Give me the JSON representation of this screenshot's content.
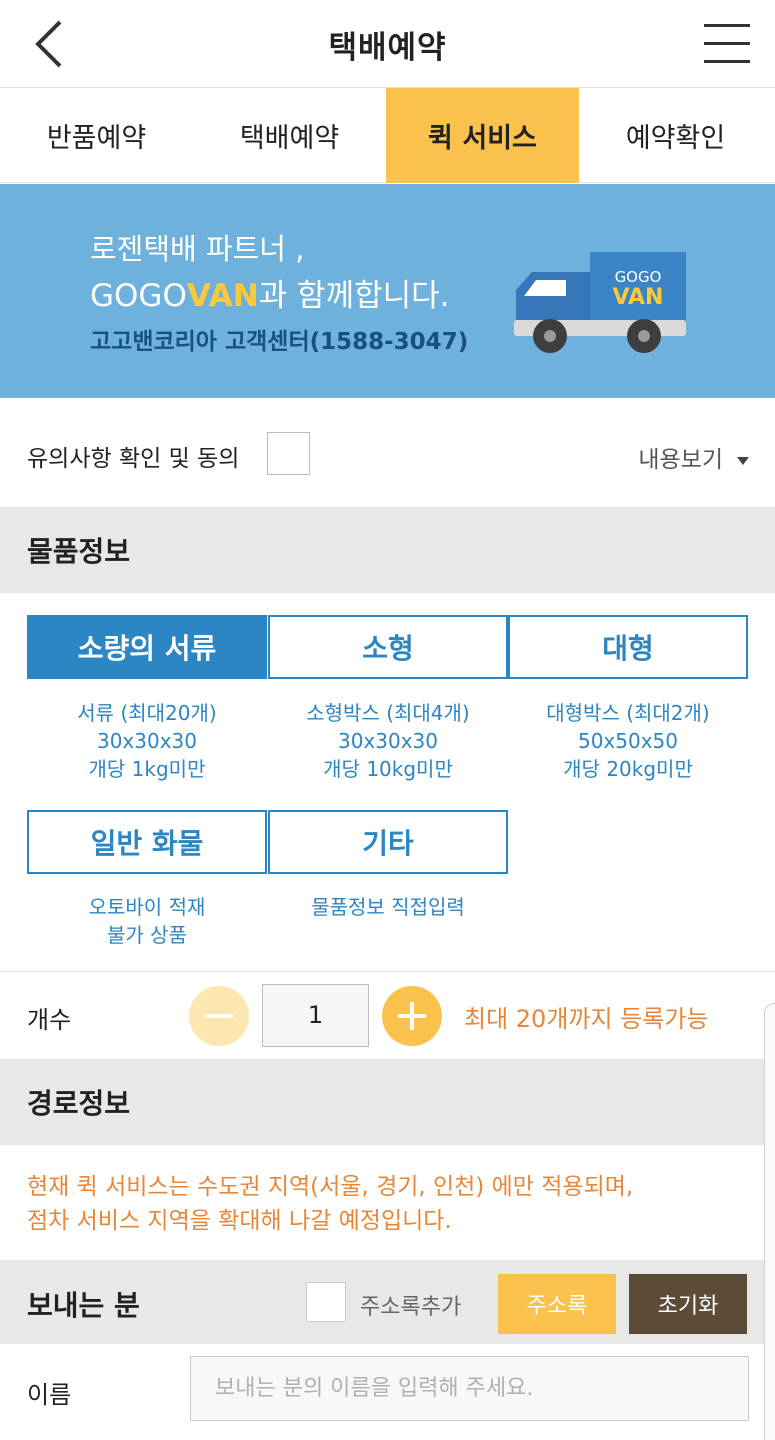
{
  "header": {
    "title": "택배예약"
  },
  "tabs": [
    {
      "label": "반품예약",
      "active": false
    },
    {
      "label": "택배예약",
      "active": false
    },
    {
      "label": "퀵 서비스",
      "active": true
    },
    {
      "label": "예약확인",
      "active": false
    }
  ],
  "banner": {
    "line1": "로젠택배 파트너 ,",
    "line2_brand_a": "GOGO",
    "line2_brand_b": "VAN",
    "line2_rest": "과 함께합니다.",
    "phone": "고고밴코리아 고객센터(1588-3047)",
    "truck_logo_top": "GOGO",
    "truck_logo_bottom": "VAN"
  },
  "agree": {
    "label": "유의사항 확인 및 동의",
    "view_more": "내용보기",
    "checked": false
  },
  "item_info": {
    "title": "물품정보",
    "options": [
      {
        "label": "소량의 서류",
        "selected": true,
        "desc": [
          "서류 (최대20개)",
          "30x30x30",
          "개당 1kg미만"
        ]
      },
      {
        "label": "소형",
        "selected": false,
        "desc": [
          "소형박스 (최대4개)",
          "30x30x30",
          "개당 10kg미만"
        ]
      },
      {
        "label": "대형",
        "selected": false,
        "desc": [
          "대형박스 (최대2개)",
          "50x50x50",
          "개당 20kg미만"
        ]
      },
      {
        "label": "일반 화물",
        "selected": false,
        "desc": [
          "오토바이 적재",
          "불가 상품"
        ]
      },
      {
        "label": "기타",
        "selected": false,
        "desc": [
          "물품정보 직접입력"
        ]
      }
    ]
  },
  "quantity": {
    "label": "개수",
    "value": "1",
    "note": "최대 20개까지 등록가능"
  },
  "route_info": {
    "title": "경로정보",
    "notice_line1": "현재 퀵 서비스는 수도권 지역(서울, 경기, 인천) 에만 적용되며,",
    "notice_line2": "점차 서비스 지역을 확대해 나갈 예정입니다."
  },
  "sender": {
    "title": "보내는 분",
    "address_add_label": "주소록추가",
    "address_book_button": "주소록",
    "reset_button": "초기화",
    "name_label": "이름",
    "name_placeholder": "보내는 분의 이름을 입력해 주세요.",
    "name_value": ""
  },
  "colors": {
    "accent_yellow": "#fbc24e",
    "accent_blue": "#2c86c4",
    "banner_blue": "#6fb1dd",
    "notice_orange": "#e8863a",
    "reset_brown": "#5d4c38"
  },
  "icons": [
    "back-arrow-icon",
    "hamburger-menu-icon",
    "dropdown-triangle-icon",
    "truck-icon",
    "minus-icon",
    "plus-icon"
  ]
}
